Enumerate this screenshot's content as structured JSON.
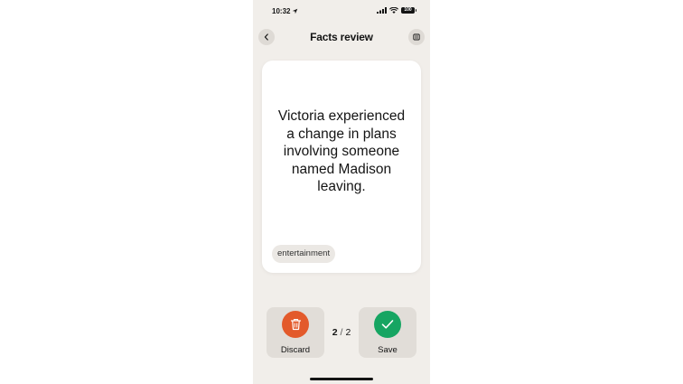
{
  "status_bar": {
    "time": "10:32",
    "battery": "100",
    "icons": [
      "location-arrow-icon",
      "signal-icon",
      "wifi-icon",
      "battery-icon"
    ]
  },
  "header": {
    "title": "Facts review",
    "back_icon": "chevron-left-icon",
    "menu_icon": "list-icon"
  },
  "card": {
    "fact": "Victoria experienced a change in plans involving someone named Madison leaving.",
    "tag": "entertainment"
  },
  "actions": {
    "discard_label": "Discard",
    "save_label": "Save",
    "discard_color": "#e35a2b",
    "save_color": "#16a562"
  },
  "pager": {
    "current": "2",
    "separator": "/",
    "total": "2"
  },
  "colors": {
    "background": "#f1eeea",
    "card": "#ffffff",
    "button": "#e1ddd8"
  }
}
